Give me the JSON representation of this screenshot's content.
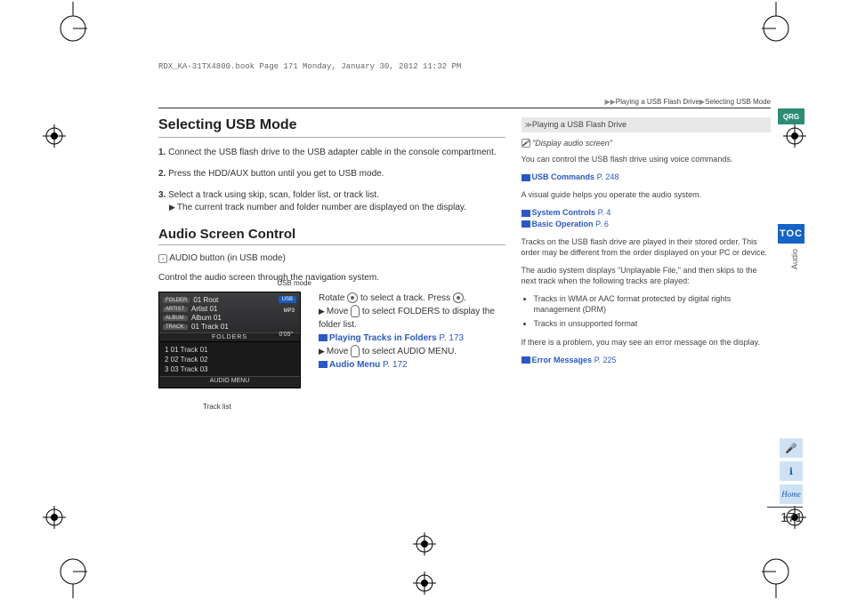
{
  "header_line": "RDX_KA-31TX4800.book  Page 171  Monday, January 30, 2012  11:32 PM",
  "breadcrumb": {
    "l1": "Playing a USB Flash Drive",
    "l2": "Selecting USB Mode"
  },
  "section1": {
    "title": "Selecting USB Mode",
    "step1_num": "1.",
    "step1": "Connect the USB flash drive to the USB adapter cable in the console compartment.",
    "step2_num": "2.",
    "step2": "Press the HDD/AUX button until you get to USB mode.",
    "step3_num": "3.",
    "step3": "Select a track using skip, scan, folder list, or track list.",
    "step3_sub": "The current track number and folder number are displayed on the display."
  },
  "section2": {
    "title": "Audio Screen Control",
    "line1": "AUDIO button (in USB mode)",
    "line2": "Control the audio screen through the navigation system.",
    "caption_usb": "USB mode",
    "caption_track": "Track list"
  },
  "usb_screen": {
    "folder_tag": "FOLDER",
    "folder_val": "01 Root",
    "artist_tag": "ARTIST",
    "artist_val": "Artist 01",
    "album_tag": "ALBUM",
    "album_val": "Album 01",
    "track_tag": "TRACK",
    "track_val": "01 Track 01",
    "usb_badge": "USB",
    "mp3_badge": "MP3",
    "time_badge": "0'05\"",
    "folders_header": "FOLDERS",
    "t1": "1  01 Track 01",
    "t2": "2  02 Track 02",
    "t3": "3  03 Track 03",
    "audiomenu_header": "AUDIO MENU"
  },
  "instructions": {
    "rotate_a": "Rotate ",
    "rotate_b": " to select a track. Press ",
    "rotate_c": ".",
    "move1_a": "Move ",
    "move1_b": " to select ",
    "move1_bold": "FOLDERS",
    "move1_c": " to display the folder list.",
    "link1_text": "Playing Tracks in Folders",
    "link1_page": "P. 173",
    "move2_a": "Move ",
    "move2_b": " to select ",
    "move2_bold": "AUDIO MENU",
    "move2_c": ".",
    "link2_text": "Audio Menu",
    "link2_page": "P. 172"
  },
  "right": {
    "head": "Playing a USB Flash Drive",
    "voice": "\"Display audio screen\"",
    "p1": "You can control the USB flash drive using voice commands.",
    "link1": "USB Commands",
    "link1_page": "P. 248",
    "p2": "A visual guide helps you operate the audio system.",
    "link2": "System Controls",
    "link2_page": "P. 4",
    "link3": "Basic Operation",
    "link3_page": "P. 6",
    "p3": "Tracks on the USB flash drive are played in their stored order. This order may be different from the order displayed on your PC or device.",
    "p4": "The audio system displays \"Unplayable File,\" and then skips to the next track when the following tracks are played:",
    "li1": "Tracks in WMA or AAC format protected by digital rights management (DRM)",
    "li2": "Tracks in unsupported format",
    "p5": "If there is a problem, you may see an error message on the display.",
    "link4": "Error Messages",
    "link4_page": "P. 225"
  },
  "tabs": {
    "qrg": "QRG",
    "toc": "TOC",
    "audio": "Audio",
    "home": "Home"
  },
  "page_number": "171"
}
